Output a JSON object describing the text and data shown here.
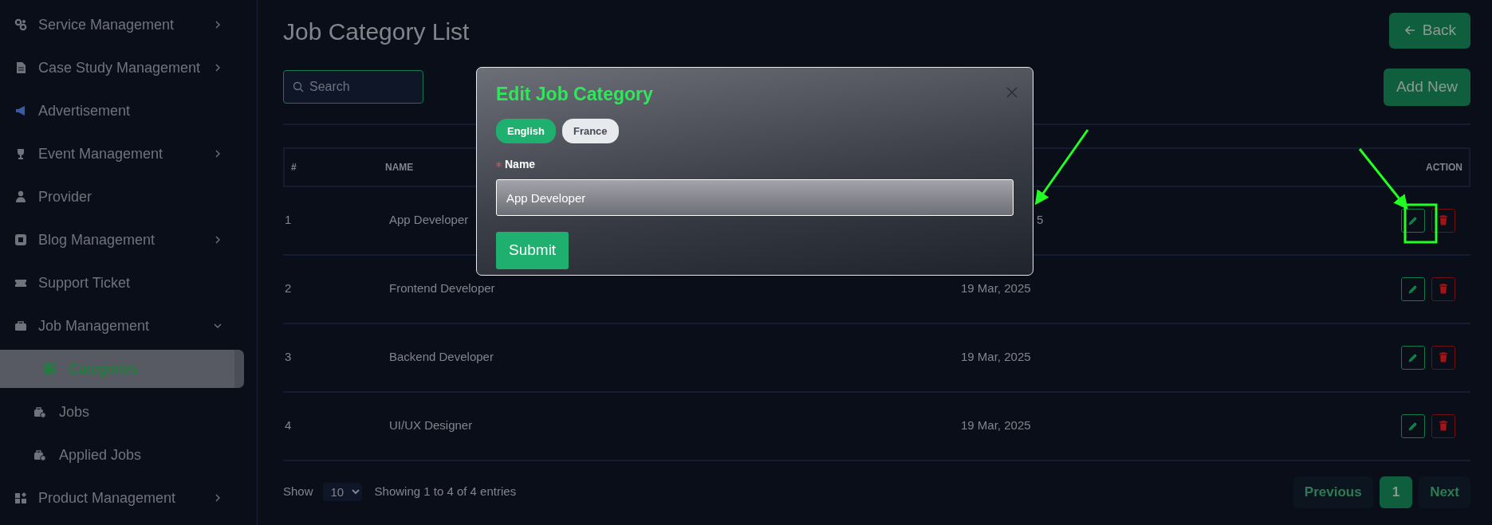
{
  "sidebar": {
    "items": [
      {
        "label": "Service Management",
        "kind": "group",
        "expanded": false
      },
      {
        "label": "Case Study Management",
        "kind": "group",
        "expanded": false
      },
      {
        "label": "Advertisement",
        "kind": "link"
      },
      {
        "label": "Event Management",
        "kind": "group",
        "expanded": false
      },
      {
        "label": "Provider",
        "kind": "link"
      },
      {
        "label": "Blog Management",
        "kind": "group",
        "expanded": false
      },
      {
        "label": "Support Ticket",
        "kind": "link"
      },
      {
        "label": "Job Management",
        "kind": "group",
        "expanded": true,
        "children": [
          {
            "label": "Categories",
            "selected": true
          },
          {
            "label": "Jobs",
            "selected": false
          },
          {
            "label": "Applied Jobs",
            "selected": false
          }
        ]
      },
      {
        "label": "Product Management",
        "kind": "group",
        "expanded": false
      }
    ]
  },
  "page": {
    "title": "Job Category List",
    "back_button": "Back",
    "add_button": "Add New",
    "search": {
      "placeholder": "Search"
    }
  },
  "table": {
    "columns": [
      "#",
      "NAME",
      "ACTION"
    ],
    "rows": [
      {
        "number": "1",
        "name": "App Developer",
        "date": "5"
      },
      {
        "number": "2",
        "name": "Frontend Developer",
        "date": "19 Mar, 2025"
      },
      {
        "number": "3",
        "name": "Backend Developer",
        "date": "19 Mar, 2025"
      },
      {
        "number": "4",
        "name": "UI/UX Designer",
        "date": "19 Mar, 2025"
      }
    ]
  },
  "footer": {
    "show_label": "Show",
    "page_size": "10",
    "entries": "Showing 1 to 4 of 4 entries",
    "pagination": [
      {
        "label": "Previous",
        "kind": "nav",
        "disabled": true,
        "selected": false
      },
      {
        "label": "1",
        "kind": "page",
        "disabled": false,
        "selected": true
      },
      {
        "label": "Next",
        "kind": "nav",
        "disabled": true,
        "selected": false
      }
    ]
  },
  "modal": {
    "title": "Edit Job Category",
    "languages": [
      {
        "label": "English",
        "selected": true
      },
      {
        "label": "France",
        "selected": false
      }
    ],
    "field": {
      "label": "Name",
      "required": true,
      "value": "App Developer"
    },
    "submit": "Submit"
  }
}
